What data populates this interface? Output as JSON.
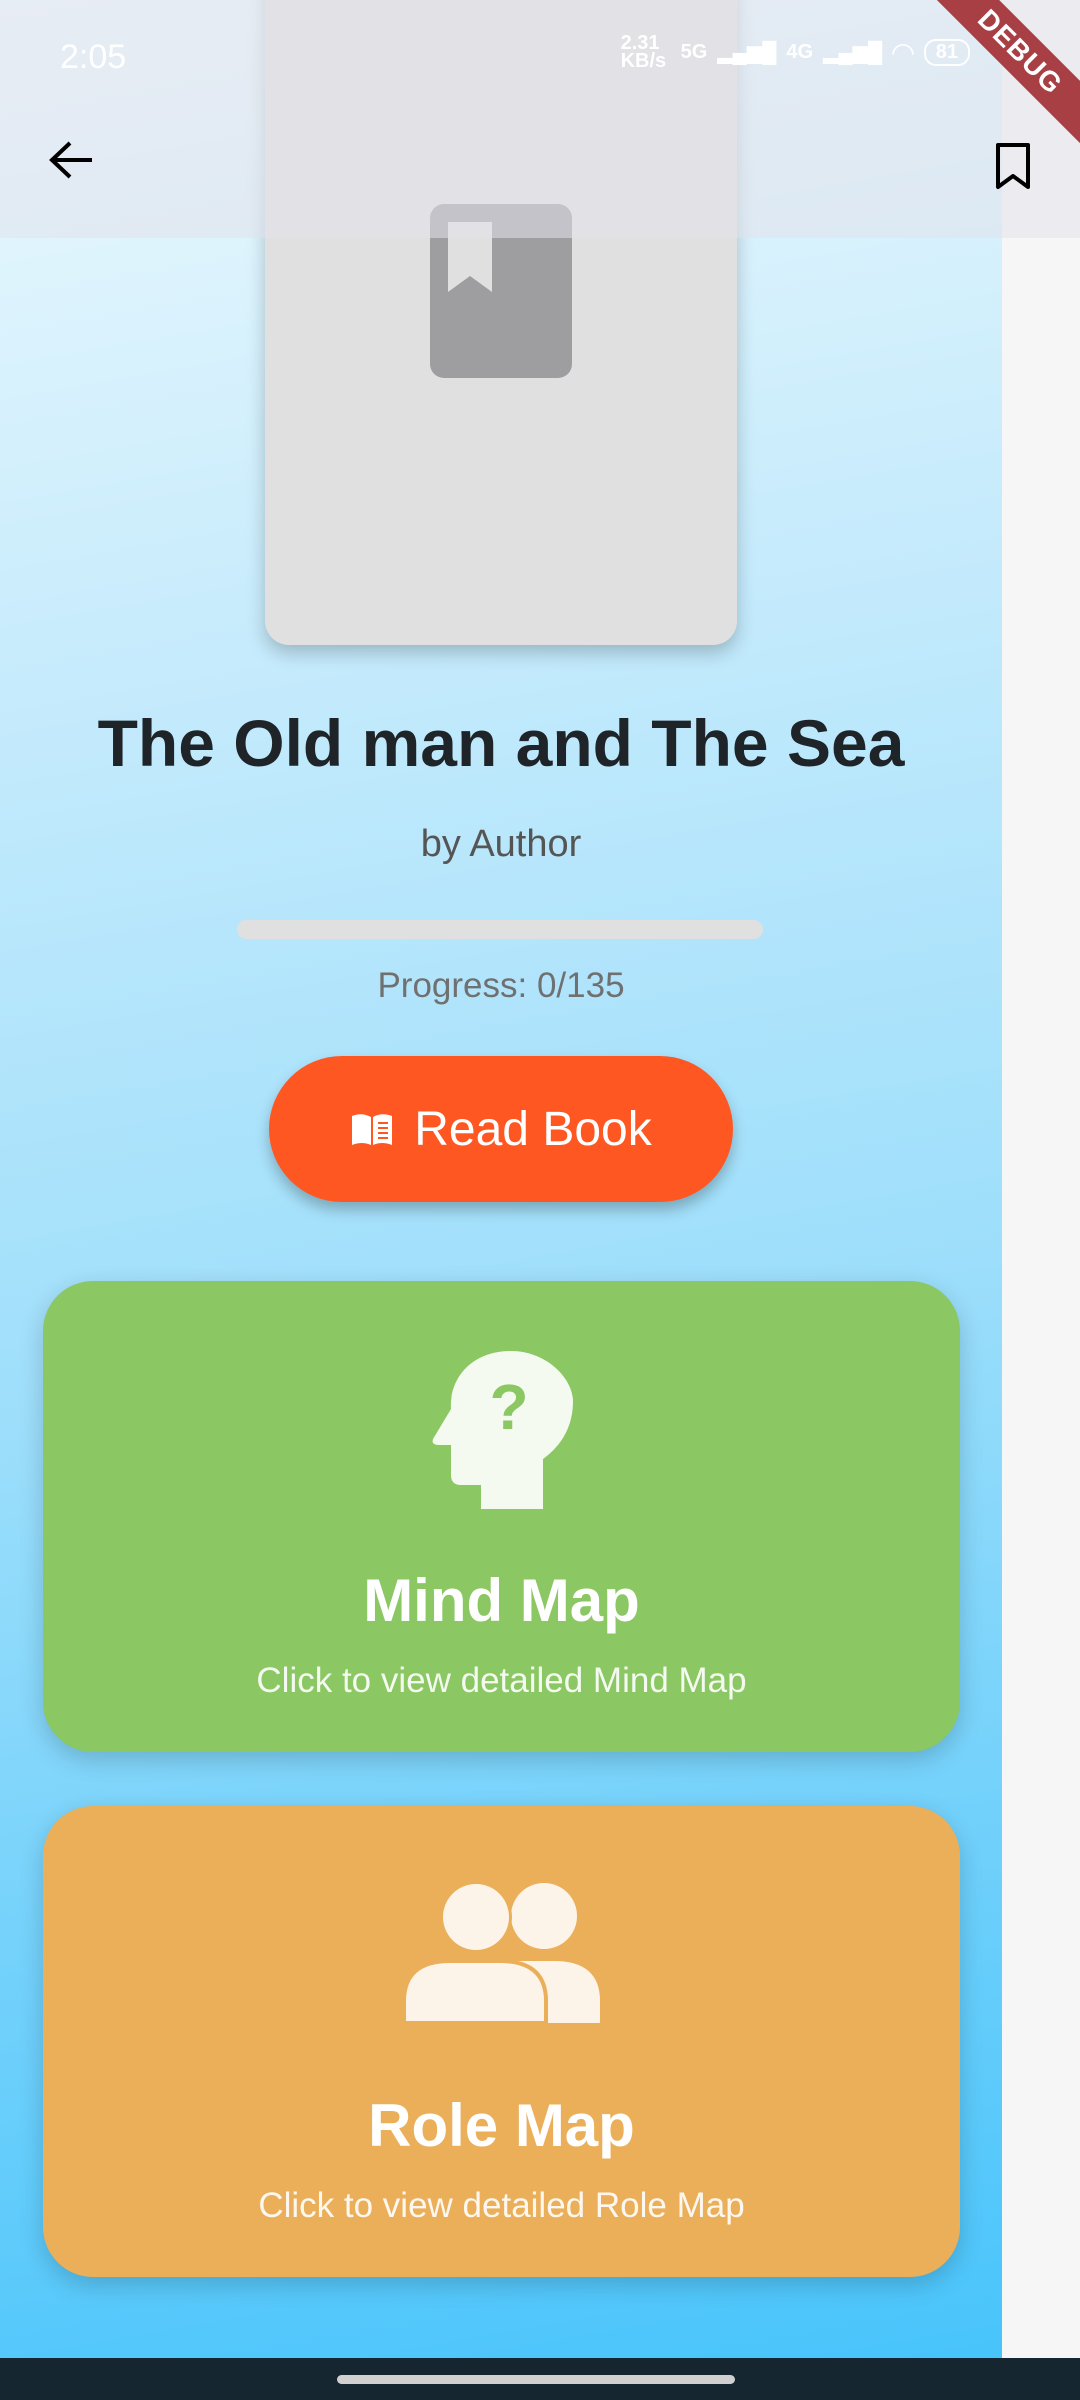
{
  "status_bar": {
    "time": "2:05",
    "net_speed": "2.31 KB/s",
    "net1": "5G",
    "net2": "4G",
    "battery": "81"
  },
  "debug_banner": "DEBUG",
  "book": {
    "title": "The Old man and The Sea",
    "author": "by Author",
    "progress_text": "Progress: 0/135",
    "progress_fraction": 0
  },
  "read_button": {
    "label": "Read Book",
    "icon": "open-book-icon"
  },
  "cards": [
    {
      "title": "Mind Map",
      "subtitle": "Click to view detailed Mind Map",
      "icon": "head-question-icon",
      "color": "#8BC763"
    },
    {
      "title": "Role Map",
      "subtitle": "Click to view detailed Role Map",
      "icon": "people-icon",
      "color": "#EBAF5A"
    }
  ],
  "colors": {
    "accent": "#FF5722"
  }
}
